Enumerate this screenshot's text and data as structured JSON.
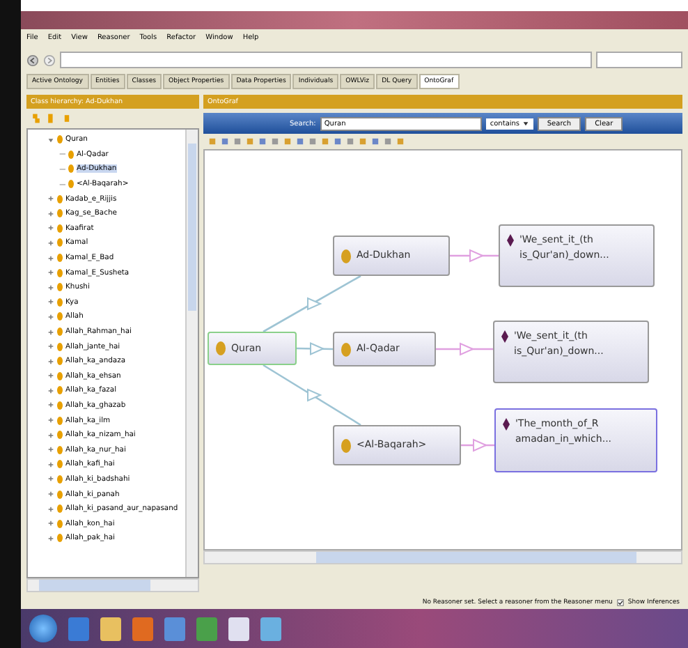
{
  "menu": [
    "File",
    "Edit",
    "View",
    "Reasoner",
    "Tools",
    "Refactor",
    "Window",
    "Help"
  ],
  "tabs": [
    {
      "label": "Active Ontology",
      "selected": false
    },
    {
      "label": "Entities",
      "selected": false
    },
    {
      "label": "Classes",
      "selected": false
    },
    {
      "label": "Object Properties",
      "selected": false
    },
    {
      "label": "Data Properties",
      "selected": false
    },
    {
      "label": "Individuals",
      "selected": false
    },
    {
      "label": "OWLViz",
      "selected": false
    },
    {
      "label": "DL Query",
      "selected": false
    },
    {
      "label": "OntoGraf",
      "selected": true
    }
  ],
  "left_panel": {
    "title": "Class hierarchy: Ad-Dukhan",
    "tree": [
      {
        "label": "Quran",
        "expanded": true,
        "selected": false,
        "children": [
          {
            "label": "Al-Qadar",
            "expanded": false,
            "selected": false
          },
          {
            "label": "Ad-Dukhan",
            "expanded": false,
            "selected": true
          },
          {
            "label": "<Al-Baqarah>",
            "expanded": false,
            "selected": false
          }
        ]
      },
      {
        "label": "Kadab_e_Rijjis",
        "expanded": false,
        "selected": false
      },
      {
        "label": "Kag_se_Bache",
        "expanded": false,
        "selected": false
      },
      {
        "label": "Kaafirat",
        "expanded": false,
        "selected": false
      },
      {
        "label": "Kamal",
        "expanded": false,
        "selected": false
      },
      {
        "label": "Kamal_E_Bad",
        "expanded": false,
        "selected": false
      },
      {
        "label": "Kamal_E_Susheta",
        "expanded": false,
        "selected": false
      },
      {
        "label": "Khushi",
        "expanded": false,
        "selected": false
      },
      {
        "label": "Kya",
        "expanded": false,
        "selected": false
      },
      {
        "label": "Allah",
        "expanded": false,
        "selected": false
      },
      {
        "label": "Allah_Rahman_hai",
        "expanded": false,
        "selected": false
      },
      {
        "label": "Allah_jante_hai",
        "expanded": false,
        "selected": false
      },
      {
        "label": "Allah_ka_andaza",
        "expanded": false,
        "selected": false
      },
      {
        "label": "Allah_ka_ehsan",
        "expanded": false,
        "selected": false
      },
      {
        "label": "Allah_ka_fazal",
        "expanded": false,
        "selected": false
      },
      {
        "label": "Allah_ka_ghazab",
        "expanded": false,
        "selected": false
      },
      {
        "label": "Allah_ka_ilm",
        "expanded": false,
        "selected": false
      },
      {
        "label": "Allah_ka_nizam_hai",
        "expanded": false,
        "selected": false
      },
      {
        "label": "Allah_ka_nur_hai",
        "expanded": false,
        "selected": false
      },
      {
        "label": "Allah_kafi_hai",
        "expanded": false,
        "selected": false
      },
      {
        "label": "Allah_ki_badshahi",
        "expanded": false,
        "selected": false
      },
      {
        "label": "Allah_ki_panah",
        "expanded": false,
        "selected": false
      },
      {
        "label": "Allah_ki_pasand_aur_napasand",
        "expanded": false,
        "selected": false
      },
      {
        "label": "Allah_kon_hai",
        "expanded": false,
        "selected": false
      },
      {
        "label": "Allah_pak_hai",
        "expanded": false,
        "selected": false
      }
    ]
  },
  "right_panel": {
    "title": "OntoGraf",
    "search": {
      "label": "Search:",
      "value": "Quran",
      "mode": "contains",
      "buttons": [
        "Search",
        "Clear"
      ]
    },
    "graph": {
      "nodes": [
        {
          "kind": "class",
          "label": "Quran",
          "selected": true
        },
        {
          "kind": "class",
          "label": "Ad-Dukhan",
          "selected": false
        },
        {
          "kind": "class",
          "label": "Al-Qadar",
          "selected": false
        },
        {
          "kind": "class",
          "label": "<Al-Baqarah>",
          "selected": false
        },
        {
          "kind": "annotation",
          "label": "'We_sent_it_(th is_Qur'an)_down...",
          "selected": false
        },
        {
          "kind": "annotation",
          "label": "'We_sent_it_(th is_Qur'an)_down...",
          "selected": false
        },
        {
          "kind": "annotation",
          "label": "'The_month_of_R amadan_in_which...",
          "selected": true
        }
      ]
    }
  },
  "status_bar": {
    "message": "No Reasoner set. Select a reasoner from the Reasoner menu",
    "show_inferences": {
      "label": "Show Inferences",
      "checked": true
    }
  }
}
